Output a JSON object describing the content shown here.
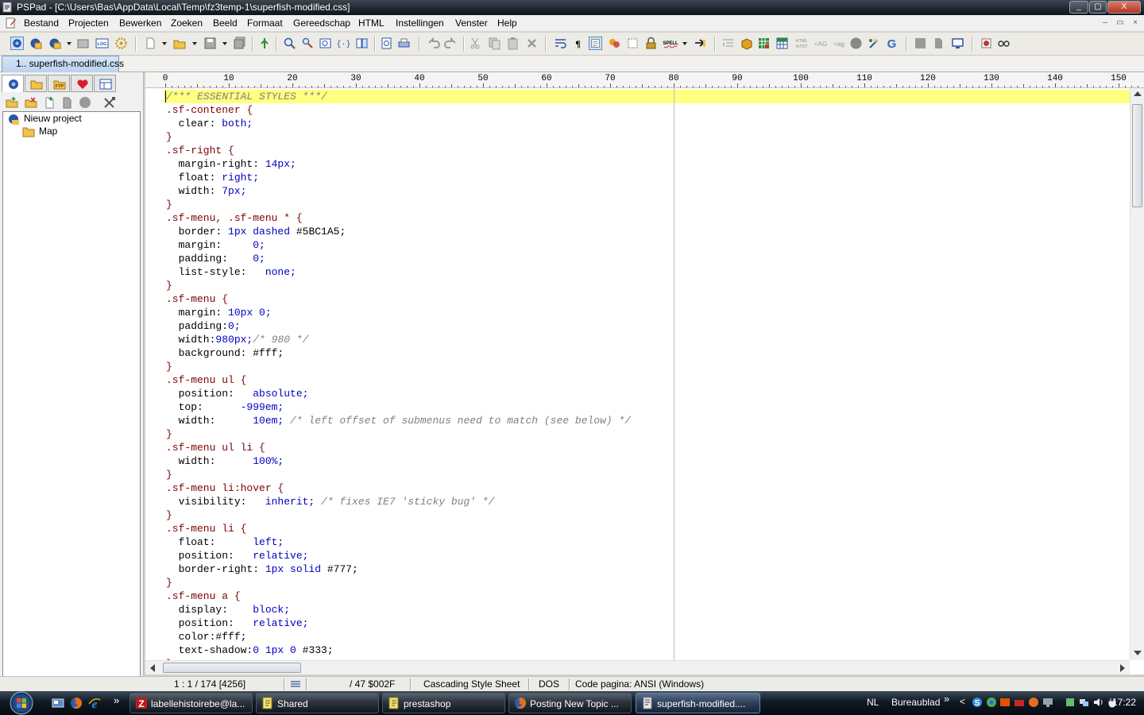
{
  "window": {
    "title": "PSPad - [C:\\Users\\Bas\\AppData\\Local\\Temp\\fz3temp-1\\superfish-modified.css]",
    "controls": [
      "_",
      "▢",
      "X"
    ]
  },
  "menu": {
    "items": [
      "Bestand",
      "Projecten",
      "Bewerken",
      "Zoeken",
      "Beeld",
      "Formaat",
      "Gereedschap",
      "HTML",
      "Instellingen",
      "Venster",
      "Help"
    ],
    "mdi_controls": [
      "–",
      "▭",
      "×"
    ]
  },
  "toolbar": {
    "buttons": [
      "project-icon",
      "open-project-icon",
      "save-project-icon",
      "recent-project-icon",
      "log-icon",
      "settings-icon",
      "new-file-icon",
      "open-file-icon",
      "save-icon",
      "save-all-icon",
      "compile-icon",
      "find-icon",
      "replace-icon",
      "find-in-files-icon",
      "bracket-icon",
      "compare-icon",
      "preview-icon",
      "print-icon",
      "undo-icon",
      "redo-icon",
      "cut-icon",
      "copy-icon",
      "paste-icon",
      "delete-icon",
      "wrap-icon",
      "paragraph-icon",
      "highlight-icon",
      "color-icon",
      "column-icon",
      "lock-icon",
      "spell-icon",
      "bookmark-icon",
      "indent-icon",
      "box-icon",
      "grid-icon",
      "table-icon",
      "html-text-icon",
      "tag-icon",
      "untag-icon",
      "circle-icon",
      "tidy-icon",
      "google-icon",
      "block-icon",
      "page-icon",
      "monitor-icon",
      "record-icon",
      "glasses-icon"
    ],
    "labels": {
      "log": "LOG",
      "spell": "SPELL",
      "html_text": "HTML\n%TXT"
    }
  },
  "tabs": [
    {
      "label": "1.. superfish-modified.css",
      "active": true
    }
  ],
  "left_panel": {
    "tabs": [
      "project-tab-icon",
      "folder-tab-icon",
      "ftp-tab-icon",
      "favorites-tab-icon",
      "clips-tab-icon"
    ],
    "ftp_label": "FTP",
    "tools": [
      "add-folder-icon",
      "remove-folder-icon",
      "add-file-icon",
      "remove-file-icon",
      "disabled-icon",
      "tools-icon"
    ],
    "tree": [
      {
        "label": "Nieuw project",
        "icon": "project-icon",
        "level": 0
      },
      {
        "label": "Map",
        "icon": "folder-icon",
        "level": 1
      }
    ]
  },
  "editor": {
    "ruler": [
      "0",
      "10",
      "20",
      "30",
      "40",
      "50",
      "60",
      "70",
      "80",
      "90",
      "100",
      "110",
      "120",
      "130",
      "140",
      "150"
    ],
    "lines": [
      [
        {
          "t": "/*** ESSENTIAL STYLES ***/",
          "c": "cmt"
        }
      ],
      [
        {
          "t": ".sf-contener {",
          "c": "sel"
        }
      ],
      [
        {
          "t": "  clear: ",
          "c": "prop"
        },
        {
          "t": "both;",
          "c": "val"
        }
      ],
      [
        {
          "t": "}",
          "c": "sel"
        }
      ],
      [
        {
          "t": ".sf-right {",
          "c": "sel"
        }
      ],
      [
        {
          "t": "  margin-right: ",
          "c": "prop"
        },
        {
          "t": "14px;",
          "c": "val"
        }
      ],
      [
        {
          "t": "  float: ",
          "c": "prop"
        },
        {
          "t": "right;",
          "c": "val"
        }
      ],
      [
        {
          "t": "  width: ",
          "c": "prop"
        },
        {
          "t": "7px;",
          "c": "val"
        }
      ],
      [
        {
          "t": "}",
          "c": "sel"
        }
      ],
      [
        {
          "t": ".sf-menu, .sf-menu * {",
          "c": "sel"
        }
      ],
      [
        {
          "t": "  border: ",
          "c": "prop"
        },
        {
          "t": "1px dashed ",
          "c": "val"
        },
        {
          "t": "#5BC1A5;",
          "c": "p"
        }
      ],
      [
        {
          "t": "  margin:     ",
          "c": "prop"
        },
        {
          "t": "0;",
          "c": "val"
        }
      ],
      [
        {
          "t": "  padding:    ",
          "c": "prop"
        },
        {
          "t": "0;",
          "c": "val"
        }
      ],
      [
        {
          "t": "  list-style:   ",
          "c": "prop"
        },
        {
          "t": "none;",
          "c": "val"
        }
      ],
      [
        {
          "t": "}",
          "c": "sel"
        }
      ],
      [
        {
          "t": ".sf-menu {",
          "c": "sel"
        }
      ],
      [
        {
          "t": "  margin: ",
          "c": "prop"
        },
        {
          "t": "10px 0;",
          "c": "val"
        }
      ],
      [
        {
          "t": "  padding:",
          "c": "prop"
        },
        {
          "t": "0;",
          "c": "val"
        }
      ],
      [
        {
          "t": "  width:",
          "c": "prop"
        },
        {
          "t": "980px;",
          "c": "val"
        },
        {
          "t": "/* 980 */",
          "c": "cmt"
        }
      ],
      [
        {
          "t": "  background: ",
          "c": "prop"
        },
        {
          "t": "#fff;",
          "c": "p"
        }
      ],
      [
        {
          "t": "}",
          "c": "sel"
        }
      ],
      [
        {
          "t": ".sf-menu ul {",
          "c": "sel"
        }
      ],
      [
        {
          "t": "  position:   ",
          "c": "prop"
        },
        {
          "t": "absolute;",
          "c": "val"
        }
      ],
      [
        {
          "t": "  top:      ",
          "c": "prop"
        },
        {
          "t": "-999em;",
          "c": "val"
        }
      ],
      [
        {
          "t": "  width:      ",
          "c": "prop"
        },
        {
          "t": "10em; ",
          "c": "val"
        },
        {
          "t": "/* left offset of submenus need to match (see below) */",
          "c": "cmt"
        }
      ],
      [
        {
          "t": "}",
          "c": "sel"
        }
      ],
      [
        {
          "t": ".sf-menu ul li {",
          "c": "sel"
        }
      ],
      [
        {
          "t": "  width:      ",
          "c": "prop"
        },
        {
          "t": "100%;",
          "c": "val"
        }
      ],
      [
        {
          "t": "}",
          "c": "sel"
        }
      ],
      [
        {
          "t": ".sf-menu li:hover {",
          "c": "sel"
        }
      ],
      [
        {
          "t": "  visibility:   ",
          "c": "prop"
        },
        {
          "t": "inherit; ",
          "c": "val"
        },
        {
          "t": "/* fixes IE7 'sticky bug' */",
          "c": "cmt"
        }
      ],
      [
        {
          "t": "}",
          "c": "sel"
        }
      ],
      [
        {
          "t": ".sf-menu li {",
          "c": "sel"
        }
      ],
      [
        {
          "t": "  float:      ",
          "c": "prop"
        },
        {
          "t": "left;",
          "c": "val"
        }
      ],
      [
        {
          "t": "  position:   ",
          "c": "prop"
        },
        {
          "t": "relative;",
          "c": "val"
        }
      ],
      [
        {
          "t": "  border-right: ",
          "c": "prop"
        },
        {
          "t": "1px solid ",
          "c": "val"
        },
        {
          "t": "#777;",
          "c": "p"
        }
      ],
      [
        {
          "t": "}",
          "c": "sel"
        }
      ],
      [
        {
          "t": ".sf-menu a {",
          "c": "sel"
        }
      ],
      [
        {
          "t": "  display:    ",
          "c": "prop"
        },
        {
          "t": "block;",
          "c": "val"
        }
      ],
      [
        {
          "t": "  position:   ",
          "c": "prop"
        },
        {
          "t": "relative;",
          "c": "val"
        }
      ],
      [
        {
          "t": "  color:",
          "c": "prop"
        },
        {
          "t": "#fff;",
          "c": "p"
        }
      ],
      [
        {
          "t": "  text-shadow:",
          "c": "prop"
        },
        {
          "t": "0 1px 0 ",
          "c": "val"
        },
        {
          "t": "#333;",
          "c": "p"
        }
      ],
      [
        {
          "t": "}",
          "c": "sel"
        }
      ]
    ],
    "colors": {
      "selector": "#800000",
      "value": "#0000c0",
      "comment": "#808080",
      "current_line": "#ffff80"
    }
  },
  "status": {
    "position": "1 : 1 / 174 [4256]",
    "char": "/  47  $002F",
    "syntax": "Cascading Style Sheet",
    "line_end": "DOS",
    "codepage": "Code pagina: ANSI (Windows)"
  },
  "taskbar": {
    "quicklaunch": [
      "show-desktop-icon",
      "firefox-icon",
      "ie-icon"
    ],
    "overflow": "»",
    "tasks": [
      {
        "label": "labellehistoirebe@la...",
        "icon": "filezilla-icon",
        "active": false
      },
      {
        "label": "Shared",
        "icon": "pspad-icon",
        "active": false
      },
      {
        "label": "prestashop",
        "icon": "pspad-icon",
        "active": false
      },
      {
        "label": "Posting New Topic ...",
        "icon": "firefox-icon",
        "active": false
      },
      {
        "label": "superfish-modified....",
        "icon": "pspad-icon",
        "active": true
      }
    ],
    "language": "NL",
    "desktop_label": "Bureaublad",
    "desktop_overflow": "»",
    "tray_collapse": "<",
    "clock": "17:22"
  }
}
